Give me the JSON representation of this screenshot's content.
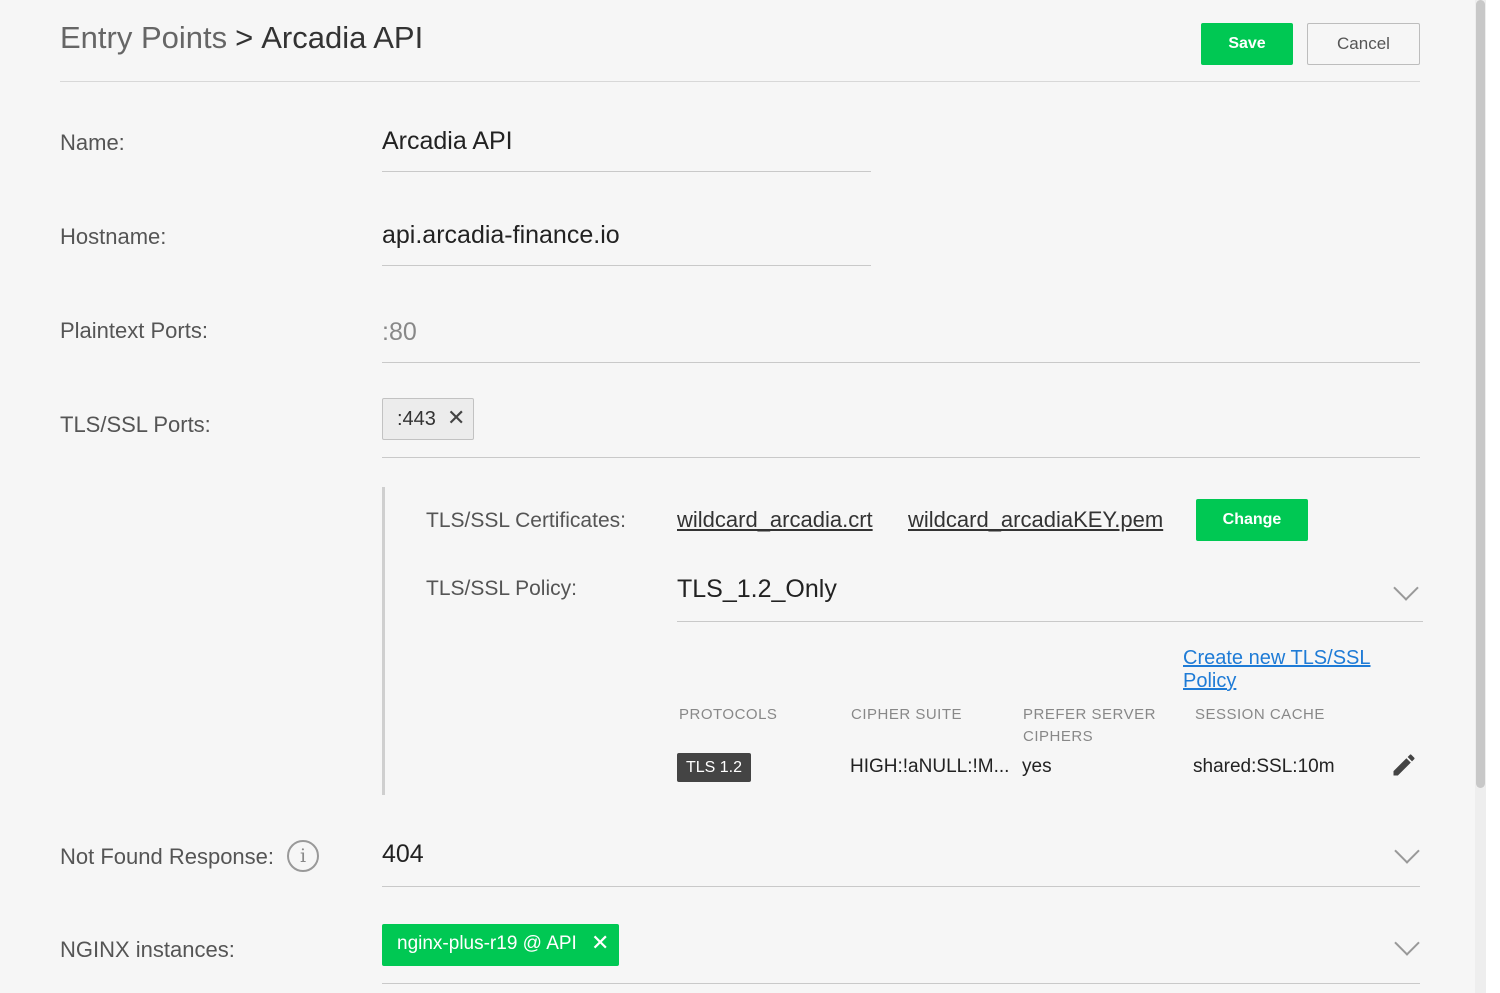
{
  "header": {
    "breadcrumb_parent": "Entry Points",
    "breadcrumb_separator": ">",
    "breadcrumb_current": "Arcadia API",
    "save_label": "Save",
    "cancel_label": "Cancel"
  },
  "form": {
    "name": {
      "label": "Name:",
      "value": "Arcadia API"
    },
    "hostname": {
      "label": "Hostname:",
      "value": "api.arcadia-finance.io"
    },
    "plaintext_ports": {
      "label": "Plaintext Ports:",
      "placeholder": ":80"
    },
    "tls_ports": {
      "label": "TLS/SSL Ports:",
      "chips": [
        ":443"
      ],
      "remove_glyph": "✕"
    },
    "tls": {
      "certificates_label": "TLS/SSL Certificates:",
      "certificate_file": "wildcard_arcadia.crt",
      "key_file": "wildcard_arcadiaKEY.pem",
      "change_label": "Change",
      "policy_label": "TLS/SSL Policy:",
      "policy_value": "TLS_1.2_Only",
      "create_policy_link": "Create new TLS/SSL Policy",
      "table": {
        "headers": [
          "PROTOCOLS",
          "CIPHER SUITE",
          "PREFER SERVER CIPHERS",
          "SESSION CACHE"
        ],
        "row": {
          "protocols": "TLS 1.2",
          "cipher_suite": "HIGH:!aNULL:!M...",
          "prefer_server_ciphers": "yes",
          "session_cache": "shared:SSL:10m"
        }
      }
    },
    "not_found_response": {
      "label": "Not Found Response:",
      "value": "404",
      "info_glyph": "i"
    },
    "nginx_instances": {
      "label": "NGINX instances:",
      "chips": [
        "nginx-plus-r19 @ API"
      ],
      "remove_glyph": "✕"
    }
  },
  "colors": {
    "accent": "#00c853",
    "link": "#1e7bd6",
    "background": "#f6f6f6"
  },
  "icons": {
    "edit": "pencil-icon",
    "dropdown": "chevron-down-icon",
    "info": "info-icon",
    "remove": "close-icon"
  }
}
